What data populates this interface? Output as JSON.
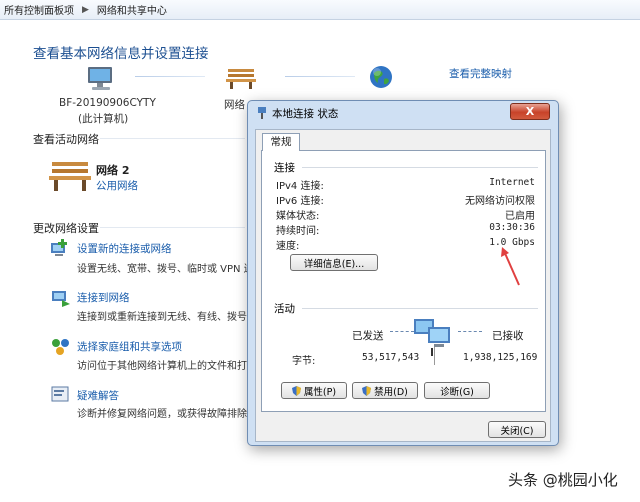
{
  "breadcrumb": {
    "items": [
      "所有控制面板项",
      "网络和共享中心"
    ]
  },
  "page": {
    "title": "查看基本网络信息并设置连接",
    "see_full_map": "查看完整映射",
    "computer": {
      "name": "BF-20190906CYTY",
      "note": "(此计算机)"
    },
    "network_short": "网络",
    "active_section": "查看活动网络",
    "active_network": {
      "name": "网络  2",
      "type": "公用网络"
    },
    "change_section": "更改网络设置",
    "tasks": [
      {
        "link": "设置新的连接或网络",
        "desc": "设置无线、宽带、拨号、临时或 VPN 连"
      },
      {
        "link": "连接到网络",
        "desc": "连接到或重新连接到无线、有线、拨号或"
      },
      {
        "link": "选择家庭组和共享选项",
        "desc": "访问位于其他网络计算机上的文件和打印"
      },
      {
        "link": "疑难解答",
        "desc": "诊断并修复网络问题，或获得故障排除信"
      }
    ]
  },
  "dialog": {
    "title": "本地连接 状态",
    "close": "X",
    "tab": "常规",
    "connection": {
      "label": "连接",
      "rows": [
        {
          "k": "IPv4 连接:",
          "v": "Internet"
        },
        {
          "k": "IPv6 连接:",
          "v": "无网络访问权限"
        },
        {
          "k": "媒体状态:",
          "v": "已启用"
        },
        {
          "k": "持续时间:",
          "v": "03:30:36"
        },
        {
          "k": "速度:",
          "v": "1.0 Gbps"
        }
      ],
      "details_button": "详细信息(E)..."
    },
    "activity": {
      "label": "活动",
      "sent_label": "已发送",
      "received_label": "已接收",
      "bytes_label": "字节:",
      "bytes_sent": "53,517,543",
      "bytes_received": "1,938,125,169"
    },
    "buttons": {
      "properties": "属性(P)",
      "disable": "禁用(D)",
      "diagnose": "诊断(G)",
      "close": "关闭(C)"
    }
  },
  "watermark": "头条 @桃园小化"
}
